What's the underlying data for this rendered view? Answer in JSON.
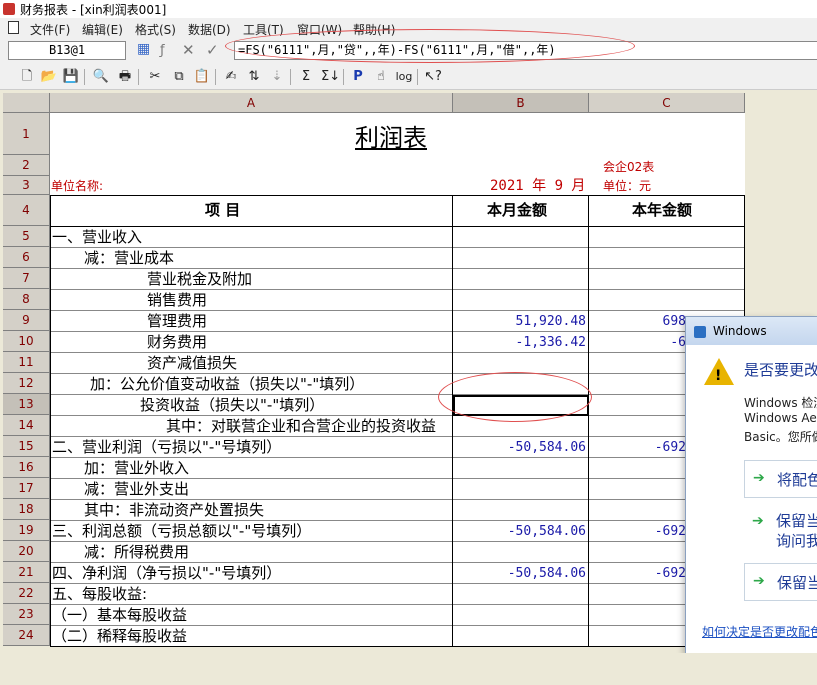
{
  "window": {
    "title": "财务报表 - [xin利润表001]"
  },
  "menu": [
    {
      "label": "文件(F)"
    },
    {
      "label": "编辑(E)"
    },
    {
      "label": "格式(S)"
    },
    {
      "label": "数据(D)"
    },
    {
      "label": "工具(T)"
    },
    {
      "label": "窗口(W)"
    },
    {
      "label": "帮助(H)"
    }
  ],
  "formula_bar": {
    "cell_ref": "B13@1",
    "formula": "=FS(\"6111\",月,\"贷\",,年)-FS(\"6111\",月,\"借\",,年)"
  },
  "toolbar": {
    "icons": [
      "new-icon",
      "open-icon",
      "save-icon",
      "print-preview-icon",
      "print-icon",
      "cut-icon",
      "copy-icon",
      "paste-icon",
      "format-painter-icon",
      "insert-row-icon",
      "sort-icon",
      "sum-icon",
      "sort-sum-icon",
      "p-icon",
      "pointer-icon",
      "log-icon",
      "help-icon"
    ]
  },
  "sheet": {
    "columns": [
      "A",
      "B",
      "C"
    ],
    "rows": [
      "1",
      "2",
      "3",
      "4",
      "5",
      "6",
      "7",
      "8",
      "9",
      "10",
      "11",
      "12",
      "13",
      "14",
      "15",
      "16",
      "17",
      "18",
      "19",
      "20",
      "21",
      "22",
      "23",
      "24"
    ],
    "title": "利润表",
    "form_code": "会企02表",
    "unit_name_label": "单位名称:",
    "period": "2021 年  9 月",
    "unit_label": "单位：元",
    "header": {
      "item": "项          目",
      "month": "本月金额",
      "year": "本年金额"
    },
    "items": [
      {
        "label": "一、营业收入",
        "indent": 0,
        "month": "",
        "year": ""
      },
      {
        "label": "减：营业成本",
        "indent": 1,
        "month": "",
        "year": ""
      },
      {
        "label": "营业税金及附加",
        "indent": 3,
        "month": "",
        "year": ""
      },
      {
        "label": "销售费用",
        "indent": 3,
        "month": "",
        "year": ""
      },
      {
        "label": "管理费用",
        "indent": 3,
        "month": "51,920.48",
        "year": "698"
      },
      {
        "label": "财务费用",
        "indent": 3,
        "month": "-1,336.42",
        "year": "-6"
      },
      {
        "label": "资产减值损失",
        "indent": 3,
        "month": "",
        "year": ""
      },
      {
        "label": "加：公允价值变动收益（损失以\"-\"填列）",
        "indent": 1,
        "month": "",
        "year": ""
      },
      {
        "label": "投资收益（损失以\"-\"填列）",
        "indent": 2,
        "month": "",
        "year": ""
      },
      {
        "label": "其中：对联营企业和合营企业的投资收益",
        "indent": 2,
        "month": "",
        "year": ""
      },
      {
        "label": "二、营业利润（亏损以\"-\"号填列）",
        "indent": 0,
        "month": "-50,584.06",
        "year": "-692"
      },
      {
        "label": "加：营业外收入",
        "indent": 1,
        "month": "",
        "year": ""
      },
      {
        "label": "减：营业外支出",
        "indent": 1,
        "month": "",
        "year": ""
      },
      {
        "label": "其中：非流动资产处置损失",
        "indent": 1,
        "month": "",
        "year": ""
      },
      {
        "label": "三、利润总额（亏损总额以\"-\"号填列）",
        "indent": 0,
        "month": "-50,584.06",
        "year": "-692"
      },
      {
        "label": "减：所得税费用",
        "indent": 1,
        "month": "",
        "year": ""
      },
      {
        "label": "四、净利润（净亏损以\"-\"号填列）",
        "indent": 0,
        "month": "-50,584.06",
        "year": "-692"
      },
      {
        "label": "五、每股收益:",
        "indent": 0,
        "month": "",
        "year": ""
      },
      {
        "label": "（一）基本每股收益",
        "indent": 0,
        "month": "",
        "year": ""
      },
      {
        "label": "（二）稀释每股收益",
        "indent": 0,
        "month": "",
        "year": ""
      }
    ]
  },
  "dialog": {
    "title": "Windows",
    "heading": "是否要更改",
    "body": [
      "Windows 检测",
      "Windows Ae",
      "Basic。您所做"
    ],
    "options": [
      "将配色",
      "保留当",
      "询问我",
      "保留当"
    ],
    "link": "如何决定是否更改配色方"
  },
  "colors": {
    "accent_red": "#e05050",
    "numbers": "#1a1aa8",
    "header_text": "#800000",
    "dialog_heading": "#1e3b96"
  }
}
